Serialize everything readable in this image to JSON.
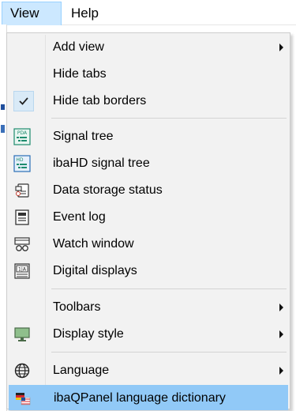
{
  "menubar": {
    "view_label": "View",
    "help_label": "Help"
  },
  "menu": {
    "items": [
      {
        "label": "Add view",
        "icon": "none",
        "submenu": true
      },
      {
        "label": "Hide tabs",
        "icon": "none"
      },
      {
        "label": "Hide tab borders",
        "icon": "checkmark-icon",
        "checked": true
      },
      {
        "label": "Signal tree",
        "icon": "pda-tree-icon",
        "icon_text": "PDA"
      },
      {
        "label": "ibaHD signal tree",
        "icon": "hd-tree-icon",
        "icon_text": "HD"
      },
      {
        "label": "Data storage status",
        "icon": "data-storage-icon"
      },
      {
        "label": "Event log",
        "icon": "event-log-icon"
      },
      {
        "label": "Watch window",
        "icon": "watch-window-icon"
      },
      {
        "label": "Digital displays",
        "icon": "digital-display-icon",
        "icon_text": "1|A"
      },
      {
        "label": "Toolbars",
        "icon": "none",
        "submenu": true
      },
      {
        "label": "Display style",
        "icon": "monitor-icon",
        "submenu": true
      },
      {
        "label": "Language",
        "icon": "globe-icon",
        "submenu": true
      },
      {
        "label": "ibaQPanel language dictionary",
        "icon": "flags-icon",
        "highlighted": true
      }
    ]
  },
  "colors": {
    "menu_bg": "#f2f2f2",
    "highlight": "#91c9f7",
    "menubar_active": "#cce8ff",
    "icon_green": "#1e8c6e"
  }
}
